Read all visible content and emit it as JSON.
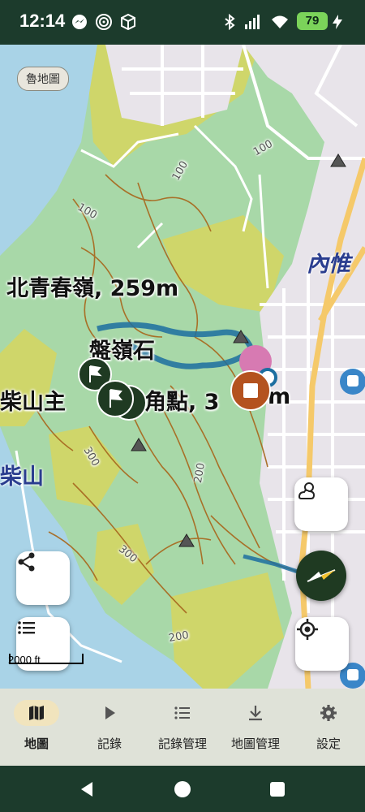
{
  "status_bar": {
    "time": "12:14",
    "battery": "79",
    "icons": [
      "messenger-icon",
      "spiral-icon",
      "package-icon",
      "bluetooth-icon",
      "signal-icon",
      "wifi-icon",
      "charging-icon"
    ]
  },
  "map": {
    "layer_chip": "魯地圖",
    "labels": {
      "peak_north": "北青春嶺, 259m",
      "rock": "盤嶺石",
      "peak_main": "柴山主",
      "peak_main_tail": "角點, 3",
      "peak_main_unit": "m",
      "mountain": "柴山",
      "district": "內惟"
    },
    "contours": [
      "100",
      "100",
      "100",
      "300",
      "200",
      "200",
      "300"
    ],
    "scale": "2000 ft",
    "colors": {
      "forest": "#a8d8a8",
      "scrub": "#cfd66a",
      "track": "#1c6ea0",
      "urban": "#e8e4ea",
      "trail": "#a86b22"
    }
  },
  "buttons": {
    "share": "share-icon",
    "list": "list-icon",
    "weather": "weather-icon",
    "compass": "compass-icon",
    "locate": "my-location-icon"
  },
  "nav": {
    "items": [
      {
        "label": "地圖",
        "icon": "map-icon",
        "active": true
      },
      {
        "label": "記錄",
        "icon": "play-icon",
        "active": false
      },
      {
        "label": "記錄管理",
        "icon": "list-icon",
        "active": false
      },
      {
        "label": "地圖管理",
        "icon": "download-icon",
        "active": false
      },
      {
        "label": "設定",
        "icon": "gear-icon",
        "active": false
      }
    ]
  },
  "system_nav": [
    "back-icon",
    "home-icon",
    "recents-icon"
  ]
}
